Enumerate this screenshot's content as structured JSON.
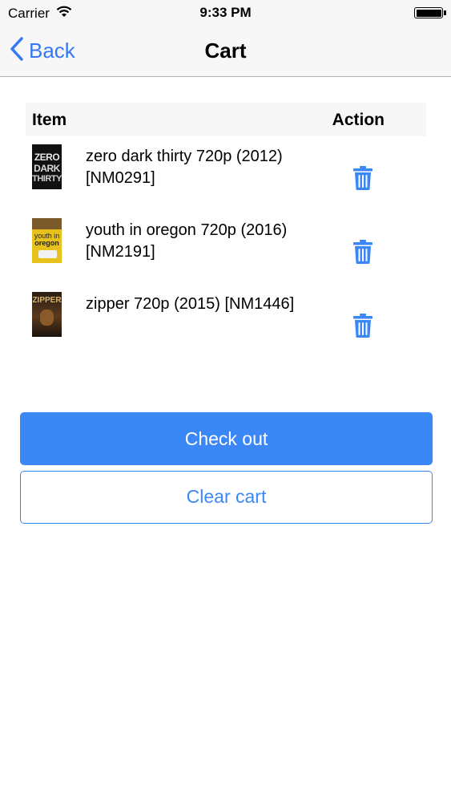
{
  "status_bar": {
    "carrier": "Carrier",
    "time": "9:33 PM",
    "wifi_icon": "wifi-icon",
    "battery_icon": "battery-icon"
  },
  "nav": {
    "back_label": "Back",
    "title": "Cart",
    "back_icon": "chevron-left-icon"
  },
  "table": {
    "col_item": "Item",
    "col_action": "Action"
  },
  "items": [
    {
      "title": "zero dark thirty 720p (2012) [NM0291]",
      "poster_text": "ZERO DARK THIRTY",
      "action_icon": "trash-icon"
    },
    {
      "title": "youth in oregon 720p (2016) [NM2191]",
      "poster_text": "youth in oregon",
      "action_icon": "trash-icon"
    },
    {
      "title": "zipper 720p (2015) [NM1446]",
      "poster_text": "ZIPPER",
      "action_icon": "trash-icon"
    }
  ],
  "buttons": {
    "checkout": "Check out",
    "clear": "Clear cart"
  },
  "colors": {
    "accent": "#3c87f6",
    "bar_bg": "#f7f7f7"
  }
}
